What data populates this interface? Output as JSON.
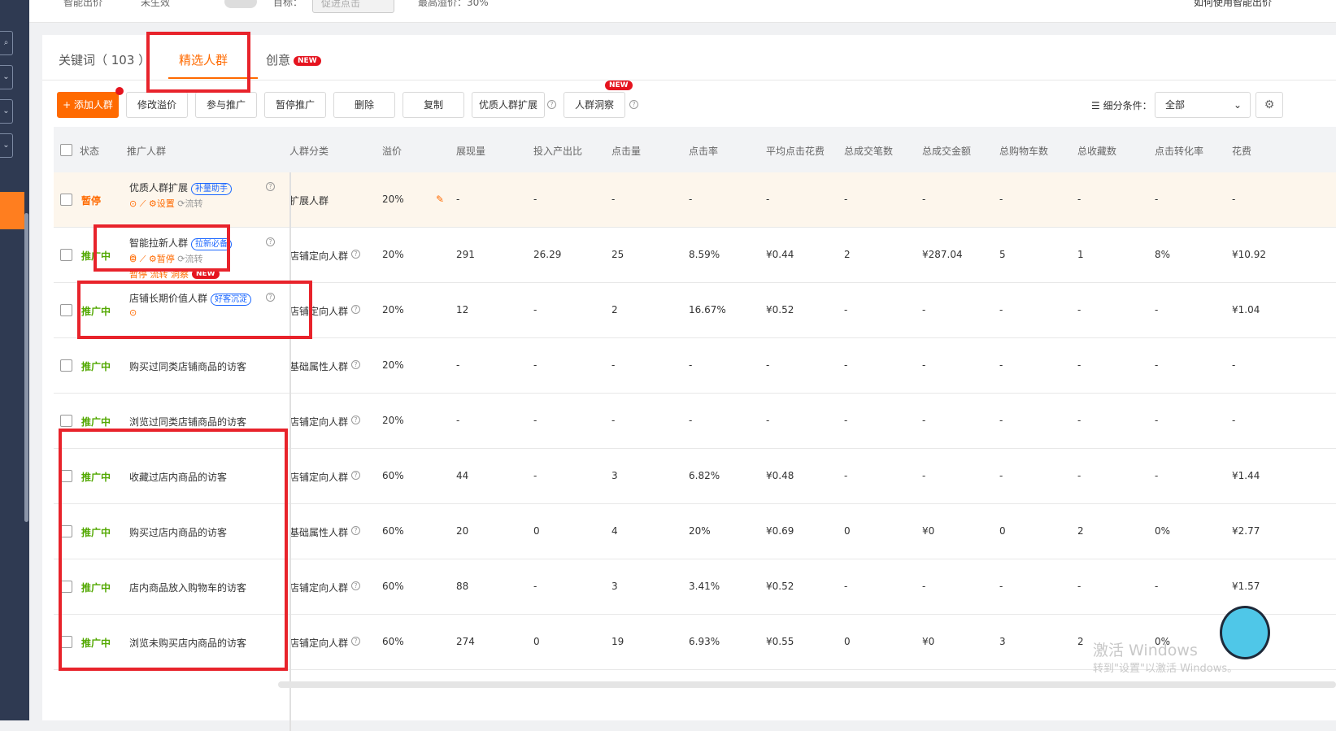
{
  "topbar": {
    "smart_bid_label": "智能出价",
    "not_active_label": "未生效",
    "target_label": "目标：",
    "target_select_placeholder": "促进点击",
    "max_bid_label": "最高溢价：30%",
    "howto_link": "如何使用智能出价"
  },
  "tabs": [
    {
      "label": "关键词（ 103 ）"
    },
    {
      "label": "精选人群"
    },
    {
      "label": "创意",
      "badge": "NEW"
    }
  ],
  "toolbar": {
    "add_label": "+ 添加人群",
    "buttons": [
      "修改溢价",
      "参与推广",
      "暂停推广",
      "删除",
      "复制",
      "优质人群扩展",
      "人群洞察"
    ],
    "insight_badge": "NEW",
    "filter_label": "细分条件：",
    "filter_value": "全部"
  },
  "table": {
    "headers": [
      "状态",
      "推广人群",
      "人群分类",
      "溢价",
      "展现量",
      "投入产出比",
      "点击量",
      "点击率",
      "平均点击花费",
      "总成交笔数",
      "总成交金额",
      "总购物车数",
      "总收藏数",
      "点击转化率",
      "花费"
    ],
    "rows": [
      {
        "status": "暂停",
        "name": "优质人群扩展",
        "tag": "补量助手",
        "actions": "设置",
        "actions2": "流转",
        "category": "扩展人群",
        "premium": "20%",
        "impressions": "-",
        "roi": "-",
        "clicks": "-",
        "ctr": "-",
        "cpc": "-",
        "deals": "-",
        "amount": "-",
        "cart": "-",
        "fav": "-",
        "cvr": "-",
        "cost": "-"
      },
      {
        "status": "推广中",
        "name": "智能拉新人群",
        "tag": "拉新必备",
        "actions": "暂停",
        "actions2": "流转",
        "actions3": "洞察",
        "new_badge": "NEW",
        "category": "店铺定向人群",
        "premium": "20%",
        "impressions": "291",
        "roi": "26.29",
        "clicks": "25",
        "ctr": "8.59%",
        "cpc": "¥0.44",
        "deals": "2",
        "amount": "¥287.04",
        "cart": "5",
        "fav": "1",
        "cvr": "8%",
        "cost": "¥10.92"
      },
      {
        "status": "推广中",
        "name": "店铺长期价值人群",
        "tag": "好客沉淀",
        "category": "店铺定向人群",
        "premium": "20%",
        "impressions": "12",
        "roi": "-",
        "clicks": "2",
        "ctr": "16.67%",
        "cpc": "¥0.52",
        "deals": "-",
        "amount": "-",
        "cart": "-",
        "fav": "-",
        "cvr": "-",
        "cost": "¥1.04"
      },
      {
        "status": "推广中",
        "name": "购买过同类店铺商品的访客",
        "category": "基础属性人群",
        "premium": "20%",
        "impressions": "-",
        "roi": "-",
        "clicks": "-",
        "ctr": "-",
        "cpc": "-",
        "deals": "-",
        "amount": "-",
        "cart": "-",
        "fav": "-",
        "cvr": "-",
        "cost": "-"
      },
      {
        "status": "推广中",
        "name": "浏览过同类店铺商品的访客",
        "category": "店铺定向人群",
        "premium": "20%",
        "impressions": "-",
        "roi": "-",
        "clicks": "-",
        "ctr": "-",
        "cpc": "-",
        "deals": "-",
        "amount": "-",
        "cart": "-",
        "fav": "-",
        "cvr": "-",
        "cost": "-"
      },
      {
        "status": "推广中",
        "name": "收藏过店内商品的访客",
        "category": "店铺定向人群",
        "premium": "60%",
        "impressions": "44",
        "roi": "-",
        "clicks": "3",
        "ctr": "6.82%",
        "cpc": "¥0.48",
        "deals": "-",
        "amount": "-",
        "cart": "-",
        "fav": "-",
        "cvr": "-",
        "cost": "¥1.44"
      },
      {
        "status": "推广中",
        "name": "购买过店内商品的访客",
        "category": "基础属性人群",
        "premium": "60%",
        "impressions": "20",
        "roi": "0",
        "clicks": "4",
        "ctr": "20%",
        "cpc": "¥0.69",
        "deals": "0",
        "amount": "¥0",
        "cart": "0",
        "fav": "2",
        "cvr": "0%",
        "cost": "¥2.77"
      },
      {
        "status": "推广中",
        "name": "店内商品放入购物车的访客",
        "category": "店铺定向人群",
        "premium": "60%",
        "impressions": "88",
        "roi": "-",
        "clicks": "3",
        "ctr": "3.41%",
        "cpc": "¥0.52",
        "deals": "-",
        "amount": "-",
        "cart": "-",
        "fav": "-",
        "cvr": "-",
        "cost": "¥1.57"
      },
      {
        "status": "推广中",
        "name": "浏览未购买店内商品的访客",
        "category": "店铺定向人群",
        "premium": "60%",
        "impressions": "274",
        "roi": "0",
        "clicks": "19",
        "ctr": "6.93%",
        "cpc": "¥0.55",
        "deals": "0",
        "amount": "¥0",
        "cart": "3",
        "fav": "2",
        "cvr": "0%",
        "cost": ""
      }
    ]
  },
  "watermark": {
    "line1": "激活 Windows",
    "line2": "转到\"设置\"以激活 Windows。"
  },
  "colors": {
    "accent": "#ff6a00",
    "active_status": "#52a800",
    "annotation": "#e8232b"
  }
}
